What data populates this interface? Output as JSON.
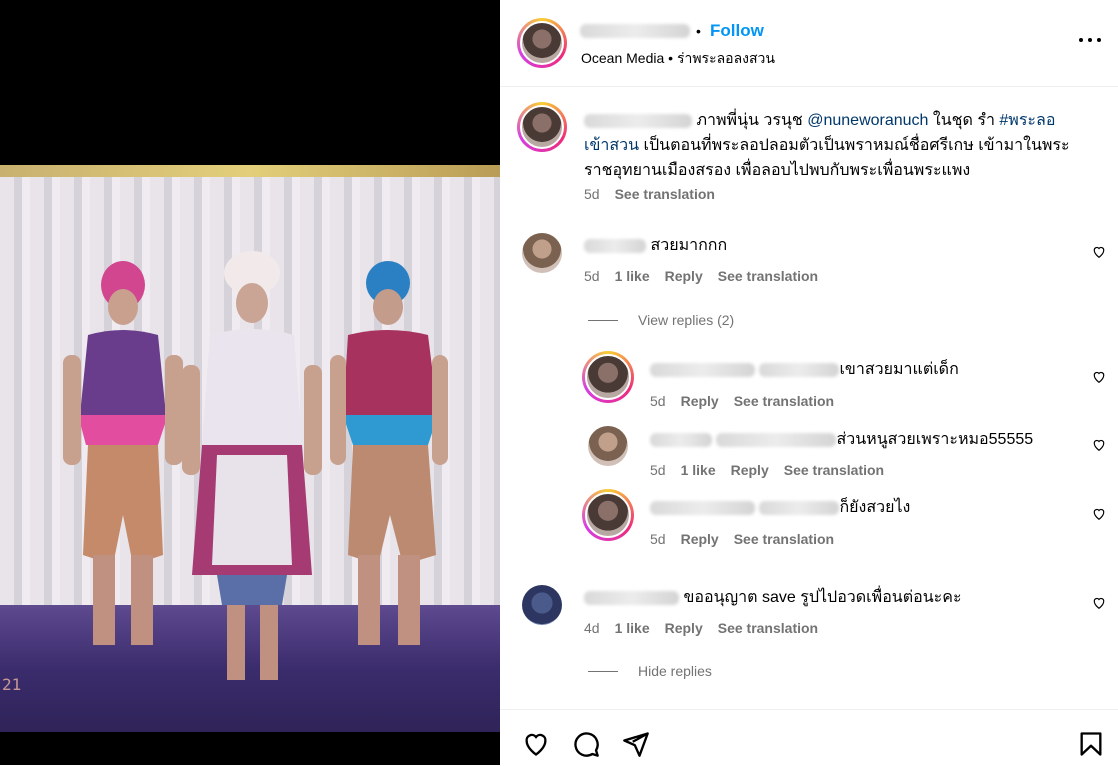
{
  "post": {
    "photo_stamp": "21",
    "header": {
      "follow_label": "Follow",
      "dot": "•",
      "location": "Ocean Media • ร่าพระลอลงสวน"
    },
    "caption": {
      "text_1": "ภาพพี่นุ่น วรนุช",
      "mention": "@nuneworanuch",
      "text_2": "ในชุด รำ",
      "hashtag_1": "#พระลอ",
      "hashtag_2": "เข้าสวน",
      "text_3": "เป็นตอนที่พระลอปลอมตัวเป็นพราหมณ์ชื่อศรีเกษ เข้ามาในพระราชอุทยานเมืองสรอง เพื่อลอบไปพบกับพระเพื่อนพระแพง",
      "time": "5d",
      "see_translation": "See translation"
    },
    "comments": [
      {
        "text": "สวยมากกก",
        "time": "5d",
        "likes": "1 like",
        "reply": "Reply",
        "see_translation": "See translation"
      },
      {
        "text": "ขออนุญาต save รูปไปอวดเพื่อนต่อนะคะ",
        "time": "4d",
        "likes": "1 like",
        "reply": "Reply",
        "see_translation": "See translation"
      }
    ],
    "view_replies": "View replies (2)",
    "hide_replies": "Hide replies",
    "replies": [
      {
        "text": "เขาสวยมาแต่เด็ก",
        "time": "5d",
        "reply": "Reply",
        "see_translation": "See translation"
      },
      {
        "text": "ส่วนหนูสวยเพราะหมอ55555",
        "time": "5d",
        "likes": "1 like",
        "reply": "Reply",
        "see_translation": "See translation"
      },
      {
        "text": "ก็ยังสวยไง",
        "time": "5d",
        "reply": "Reply",
        "see_translation": "See translation"
      }
    ]
  },
  "colors": {
    "accent": "#0095f6",
    "link": "#00376b",
    "secondary": "#737373"
  },
  "icons": [
    "more-icon",
    "heart-icon",
    "like-icon",
    "comment-icon",
    "share-icon",
    "bookmark-icon"
  ]
}
